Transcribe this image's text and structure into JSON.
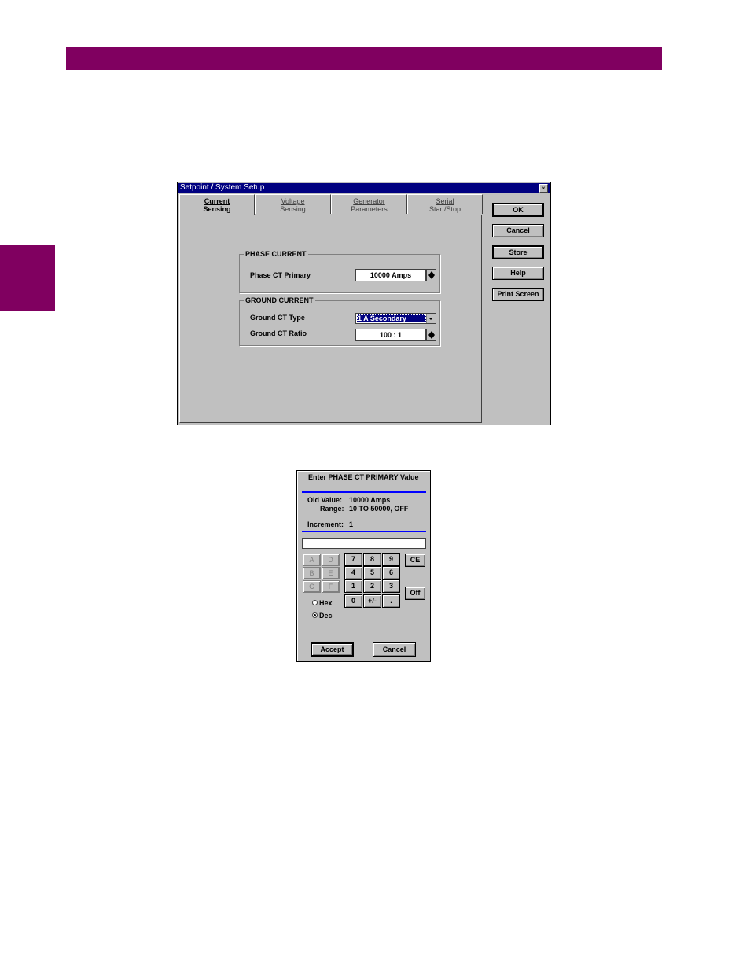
{
  "colors": {
    "accent": "#800060",
    "title_bar": "#000080",
    "divider": "#0000ff"
  },
  "window": {
    "title": "Setpoint  /  System Setup",
    "close_icon": "close-icon",
    "tabs": [
      {
        "line1": "Current",
        "line2": "Sensing",
        "active": true
      },
      {
        "line1": "Voltage",
        "line2": "Sensing",
        "active": false
      },
      {
        "line1": "Generator",
        "line2": "Parameters",
        "active": false
      },
      {
        "line1": "Serial",
        "line2": "Start/Stop",
        "active": false
      }
    ],
    "phase_group": "PHASE CURRENT",
    "phase_ct_label": "Phase CT Primary",
    "phase_ct_value": "10000 Amps",
    "ground_group": "GROUND CURRENT",
    "ground_type_label": "Ground CT Type",
    "ground_type_value": "1 A Secondary",
    "ground_ratio_label": "Ground CT Ratio",
    "ground_ratio_value": "100 : 1",
    "buttons": {
      "ok": "OK",
      "cancel": "Cancel",
      "store": "Store",
      "help": "Help",
      "print": "Print Screen"
    }
  },
  "keypad": {
    "title": "Enter PHASE CT PRIMARY Value",
    "old_label": "Old Value:",
    "old_value": "10000 Amps",
    "range_label": "Range:",
    "range_value": "10 TO 50000, OFF",
    "inc_label": "Increment:",
    "inc_value": "1",
    "entry_value": "",
    "hex_keys": [
      "A",
      "D",
      "B",
      "E",
      "C",
      "F"
    ],
    "num_keys": [
      "7",
      "8",
      "9",
      "4",
      "5",
      "6",
      "1",
      "2",
      "3",
      "0",
      "+/-",
      "."
    ],
    "ce": "CE",
    "off": "Off",
    "hex_label": "Hex",
    "dec_label": "Dec",
    "selected_base": "Dec",
    "accept": "Accept",
    "cancel": "Cancel"
  }
}
